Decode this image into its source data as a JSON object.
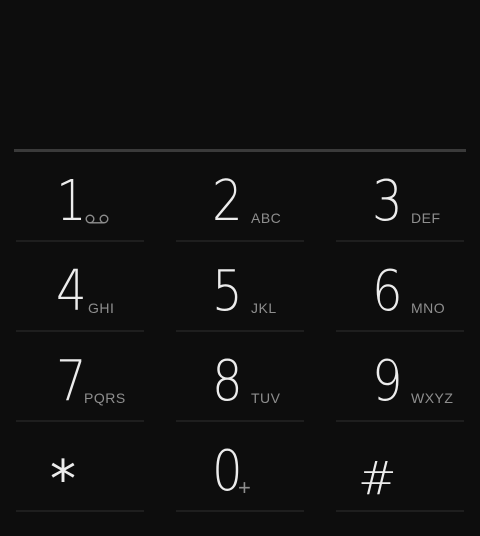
{
  "dialer": {
    "digits_value": "",
    "keys": [
      {
        "digit": "1",
        "letters": "",
        "icon": "voicemail-icon"
      },
      {
        "digit": "2",
        "letters": "ABC"
      },
      {
        "digit": "3",
        "letters": "DEF"
      },
      {
        "digit": "4",
        "letters": "GHI"
      },
      {
        "digit": "5",
        "letters": "JKL"
      },
      {
        "digit": "6",
        "letters": "MNO"
      },
      {
        "digit": "7",
        "letters": "PQRS"
      },
      {
        "digit": "8",
        "letters": "TUV"
      },
      {
        "digit": "9",
        "letters": "WXYZ"
      },
      {
        "digit": "*",
        "letters": ""
      },
      {
        "digit": "0",
        "letters": "+"
      },
      {
        "digit": "#",
        "letters": ""
      }
    ]
  },
  "colors": {
    "background": "#0d0d0d",
    "digit": "#ececec",
    "letters": "#8e8e8e",
    "divider": "#3a3a3a"
  }
}
